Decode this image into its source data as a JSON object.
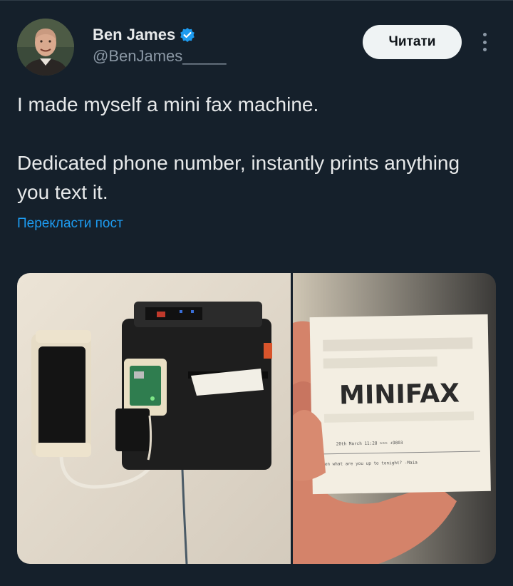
{
  "author": {
    "name": "Ben James",
    "handle": "@BenJames_____",
    "verified": true,
    "avatar_icon": "profile-photo"
  },
  "follow_button": {
    "label": "Читати"
  },
  "more_icon": "more-options-icon",
  "tweet": {
    "text": "I made myself a mini fax machine.\n\nDedicated phone number, instantly prints anything you text it."
  },
  "translate_link": "Перекласти пост",
  "media": {
    "left_image": "mini fax device mounted on wall next to phone",
    "right_image": {
      "receipt_title": "MINIFAX",
      "receipt_line1": "20th March 11:28 >>> +9803",
      "receipt_line2": "Ben what are you up to tonight? -Maia"
    }
  },
  "colors": {
    "background": "#15202b",
    "text": "#e7e9ea",
    "secondary": "#8b98a5",
    "link": "#1d9bf0",
    "verified": "#1d9bf0"
  }
}
